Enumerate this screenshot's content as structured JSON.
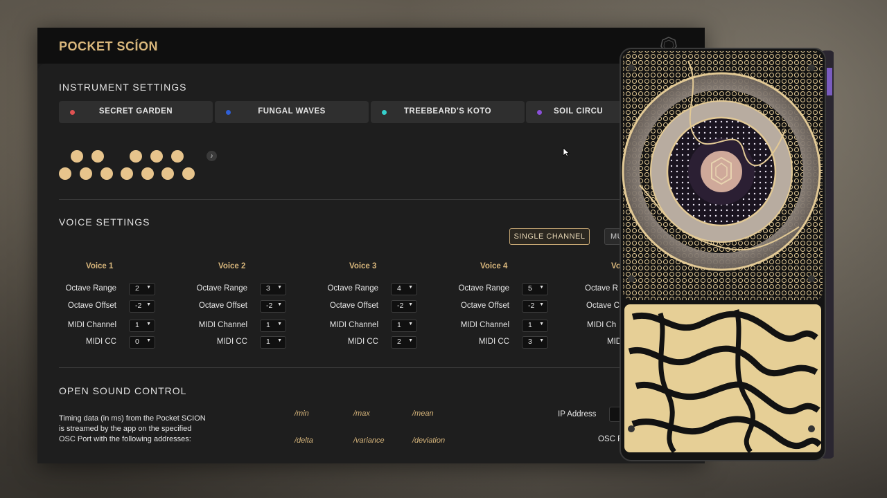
{
  "app": {
    "title": "POCKET SCÍON"
  },
  "sections": {
    "instrument": "INSTRUMENT SETTINGS",
    "voice": "VOICE SETTINGS",
    "osc": "OPEN SOUND CONTROL"
  },
  "instruments": [
    {
      "label": "SECRET GARDEN",
      "color": "#e05252"
    },
    {
      "label": "FUNGAL WAVES",
      "color": "#2f5fd6"
    },
    {
      "label": "TREEBEARD'S KOTO",
      "color": "#35d0cc"
    },
    {
      "label": "SOIL CIRCU",
      "color": "#8a4fd8"
    }
  ],
  "voice_mode": {
    "single": "SINGLE CHANNEL",
    "multi": "MU"
  },
  "row_labels": {
    "octave_range": "Octave Range",
    "octave_offset": "Octave Offset",
    "midi_channel": "MIDI Channel",
    "midi_cc": "MIDI CC"
  },
  "voices": [
    {
      "name": "Voice 1",
      "octave_range": "2",
      "octave_offset": "-2",
      "midi_channel": "1",
      "midi_cc": "0"
    },
    {
      "name": "Voice 2",
      "octave_range": "3",
      "octave_offset": "-2",
      "midi_channel": "1",
      "midi_cc": "1"
    },
    {
      "name": "Voice 3",
      "octave_range": "4",
      "octave_offset": "-2",
      "midi_channel": "1",
      "midi_cc": "2"
    },
    {
      "name": "Voice 4",
      "octave_range": "5",
      "octave_offset": "-2",
      "midi_channel": "1",
      "midi_cc": "3"
    },
    {
      "name": "Vo",
      "label_range": "Octave R",
      "label_offset": "Octave C",
      "label_channel": "MIDI Ch",
      "label_cc": "MID"
    }
  ],
  "osc": {
    "description_l1": "Timing data (in ms) from the Pocket SCION",
    "description_l2": "is streamed by the app on the specified",
    "description_l3": "OSC Port with the following addresses:",
    "addresses": [
      "/min",
      "/max",
      "/mean",
      "/delta",
      "/variance",
      "/deviation"
    ],
    "ip_label": "IP Address",
    "port_label": "OSC Po"
  },
  "accent_color": "#d9b77c"
}
